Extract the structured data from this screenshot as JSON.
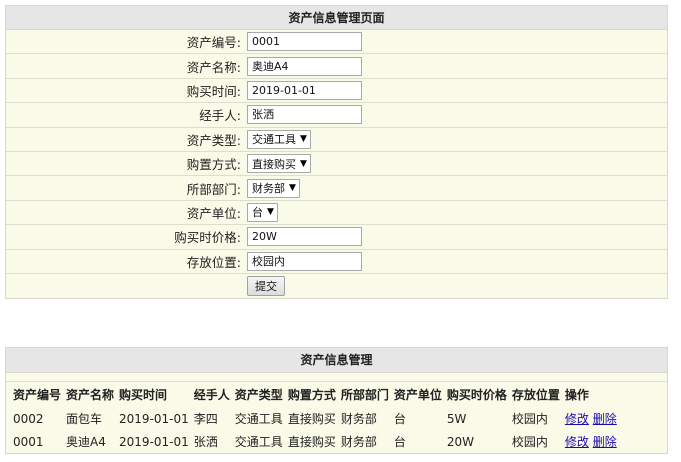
{
  "form": {
    "title": "资产信息管理页面",
    "fields": [
      {
        "label": "资产编号:",
        "value": "0001",
        "kind": "text"
      },
      {
        "label": "资产名称:",
        "value": "奥迪A4",
        "kind": "text"
      },
      {
        "label": "购买时间:",
        "value": "2019-01-01",
        "kind": "text"
      },
      {
        "label": "经手人:",
        "value": "张洒",
        "kind": "text"
      },
      {
        "label": "资产类型:",
        "value": "交通工具",
        "kind": "select"
      },
      {
        "label": "购置方式:",
        "value": "直接购买",
        "kind": "select"
      },
      {
        "label": "所部部门:",
        "value": "财务部",
        "kind": "select"
      },
      {
        "label": "资产单位:",
        "value": "台",
        "kind": "select"
      },
      {
        "label": "购买时价格:",
        "value": "20W",
        "kind": "text"
      },
      {
        "label": "存放位置:",
        "value": "校园内",
        "kind": "text"
      }
    ],
    "submit_label": "提交"
  },
  "list": {
    "title": "资产信息管理",
    "columns": [
      "资产编号",
      "资产名称",
      "购买时间",
      "经手人",
      "资产类型",
      "购置方式",
      "所部部门",
      "资产单位",
      "购买时价格",
      "存放位置",
      "操作"
    ],
    "rows": [
      {
        "id": "0002",
        "name": "面包车",
        "date": "2019-01-01",
        "handler": "李四",
        "type": "交通工具",
        "method": "直接购买",
        "dept": "财务部",
        "unit": "台",
        "price": "5W",
        "location": "校园内",
        "edit": "修改",
        "delete": "删除"
      },
      {
        "id": "0001",
        "name": "奥迪A4",
        "date": "2019-01-01",
        "handler": "张洒",
        "type": "交通工具",
        "method": "直接购买",
        "dept": "财务部",
        "unit": "台",
        "price": "20W",
        "location": "校园内",
        "edit": "修改",
        "delete": "删除"
      }
    ]
  },
  "colors": {
    "link": "#1a0dab",
    "panel_bg": "#fafae8",
    "header_bg": "#e6e6e6"
  },
  "icons": {
    "dropdown": "triangle-down-icon"
  }
}
